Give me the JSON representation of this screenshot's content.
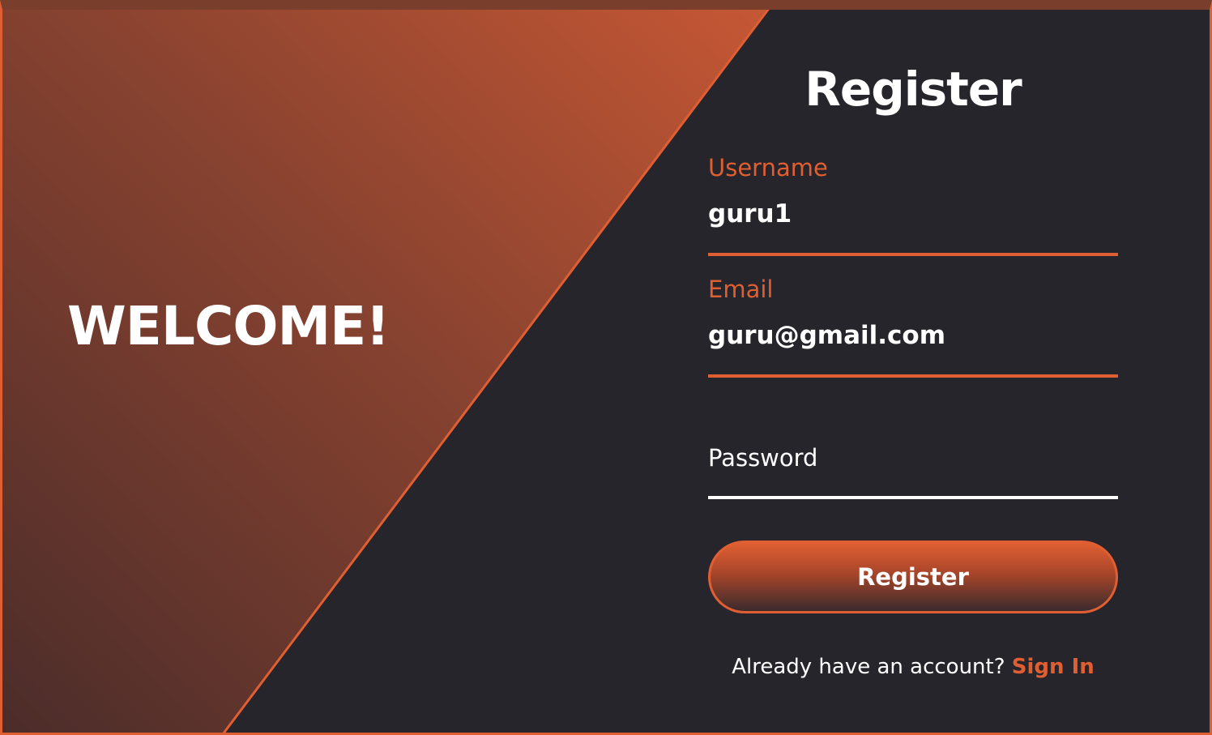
{
  "welcome": {
    "heading": "WELCOME!"
  },
  "form": {
    "title": "Register",
    "username": {
      "label": "Username",
      "value": "guru1"
    },
    "email": {
      "label": "Email",
      "value": "guru@gmail.com"
    },
    "password": {
      "label": "Password",
      "value": ""
    },
    "submit_label": "Register",
    "signin_prompt": "Already have an account?",
    "signin_link": "Sign In"
  },
  "colors": {
    "accent": "#e05f32",
    "background": "#25252b",
    "panel_gradient_start": "#4a2c2a",
    "panel_gradient_end": "#c15533",
    "text": "#ffffff"
  }
}
